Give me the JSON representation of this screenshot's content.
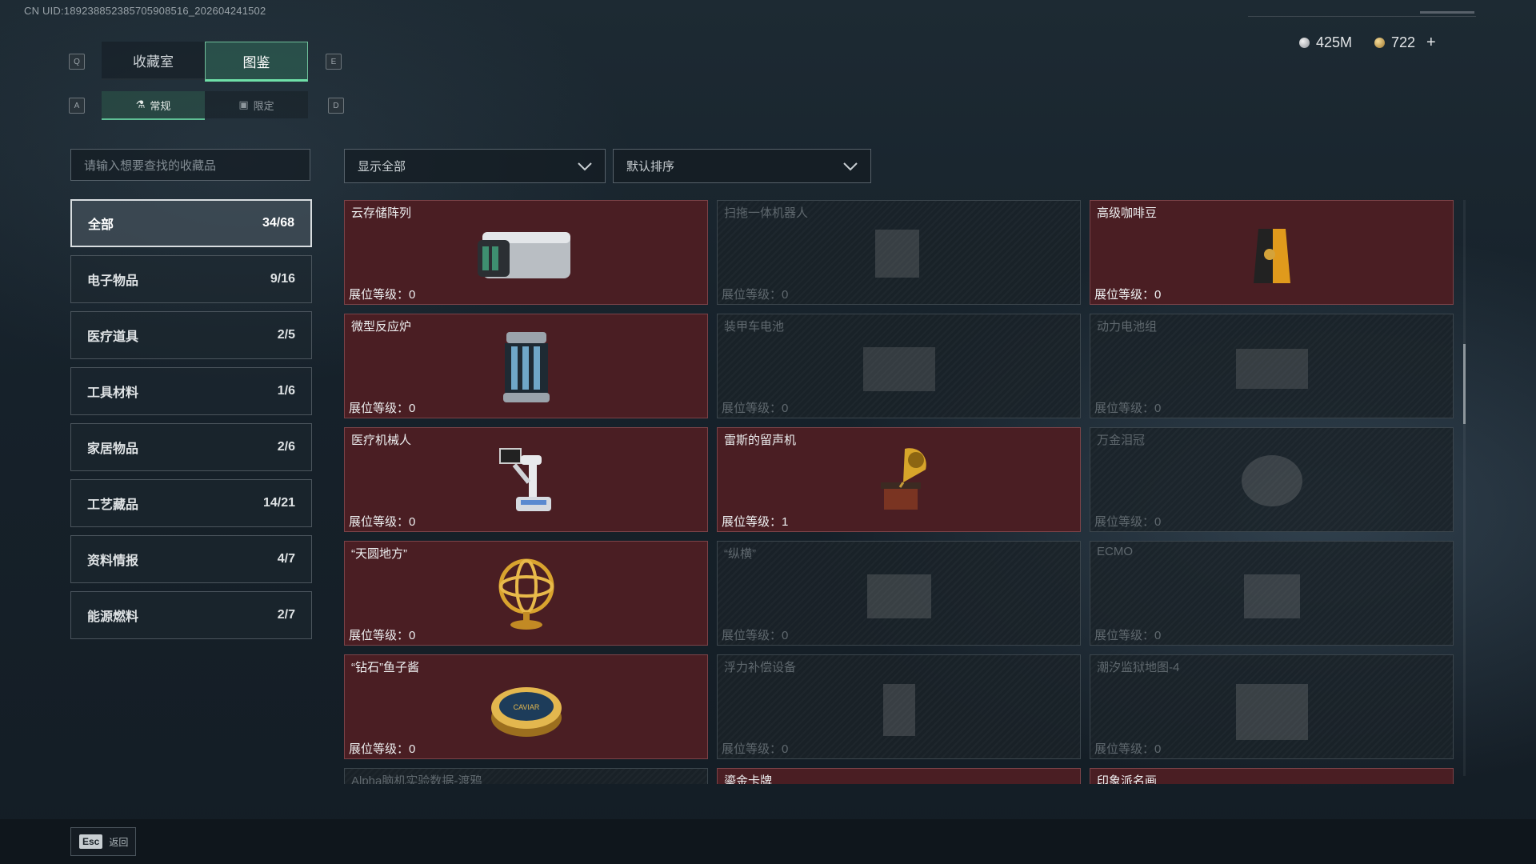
{
  "uid": "CN UID:1892388523857059085​16_202604241502",
  "currency": {
    "silver": "425M",
    "gold": "722",
    "add": "+"
  },
  "keys": {
    "tab_left": "Q",
    "tab_right": "E",
    "sub_left": "A",
    "sub_right": "D"
  },
  "tabs": [
    {
      "label": "收藏室"
    },
    {
      "label": "图鉴"
    }
  ],
  "subtabs": [
    {
      "label": "常规"
    },
    {
      "label": "限定"
    }
  ],
  "search": {
    "placeholder": "请输入想要查找的收藏品"
  },
  "filter": {
    "value": "显示全部"
  },
  "sort": {
    "value": "默认排序"
  },
  "categories": [
    {
      "label": "全部",
      "count": "34/68"
    },
    {
      "label": "电子物品",
      "count": "9/16"
    },
    {
      "label": "医疗道具",
      "count": "2/5"
    },
    {
      "label": "工具材料",
      "count": "1/6"
    },
    {
      "label": "家居物品",
      "count": "2/6"
    },
    {
      "label": "工艺藏品",
      "count": "14/21"
    },
    {
      "label": "资料情报",
      "count": "4/7"
    },
    {
      "label": "能源燃料",
      "count": "2/7"
    }
  ],
  "items": [
    {
      "name": "云存储阵列",
      "level": "展位等级：0",
      "owned": true,
      "icon": "server-array-icon"
    },
    {
      "name": "扫拖一体机器人",
      "level": "展位等级：0",
      "owned": false,
      "icon": "robot-vacuum-icon"
    },
    {
      "name": "高级咖啡豆",
      "level": "展位等级：0",
      "owned": true,
      "icon": "coffee-bag-icon"
    },
    {
      "name": "微型反应炉",
      "level": "展位等级：0",
      "owned": true,
      "icon": "reactor-icon"
    },
    {
      "name": "装甲车电池",
      "level": "展位等级：0",
      "owned": false,
      "icon": "battery-icon"
    },
    {
      "name": "动力电池组",
      "level": "展位等级：0",
      "owned": false,
      "icon": "battery-pack-icon"
    },
    {
      "name": "医疗机械人",
      "level": "展位等级：0",
      "owned": true,
      "icon": "medical-robot-icon"
    },
    {
      "name": "雷斯的留声机",
      "level": "展位等级：1",
      "owned": true,
      "icon": "gramophone-icon"
    },
    {
      "name": "万金泪冠",
      "level": "展位等级：0",
      "owned": false,
      "icon": "crown-icon"
    },
    {
      "name": "“天圆地方”",
      "level": "展位等级：0",
      "owned": true,
      "icon": "armillary-sphere-icon"
    },
    {
      "name": "“纵横”",
      "level": "展位等级：0",
      "owned": false,
      "icon": "chess-board-icon"
    },
    {
      "name": "ECMO",
      "level": "展位等级：0",
      "owned": false,
      "icon": "ecmo-icon"
    },
    {
      "name": "“钻石”鱼子酱",
      "level": "展位等级：0",
      "owned": true,
      "icon": "caviar-tin-icon"
    },
    {
      "name": "浮力补偿设备",
      "level": "展位等级：0",
      "owned": false,
      "icon": "buoyancy-device-icon"
    },
    {
      "name": "潮汐监狱地图-4",
      "level": "展位等级：0",
      "owned": false,
      "icon": "map-icon"
    },
    {
      "name": "Alpha脑机实验数据-渡鸦",
      "level": "",
      "owned": false,
      "icon": "data-icon"
    },
    {
      "name": "鎏金卡牌",
      "level": "",
      "owned": true,
      "icon": "card-icon"
    },
    {
      "name": "印象派名画",
      "level": "",
      "owned": true,
      "icon": "painting-icon"
    }
  ],
  "caviar_label": "CAVIAR",
  "esc": {
    "key": "Esc",
    "label": "返回"
  },
  "colors": {
    "accent": "#6fe0a8",
    "owned_bg": "#4a1e23",
    "locked_bg": "#1a2228"
  }
}
